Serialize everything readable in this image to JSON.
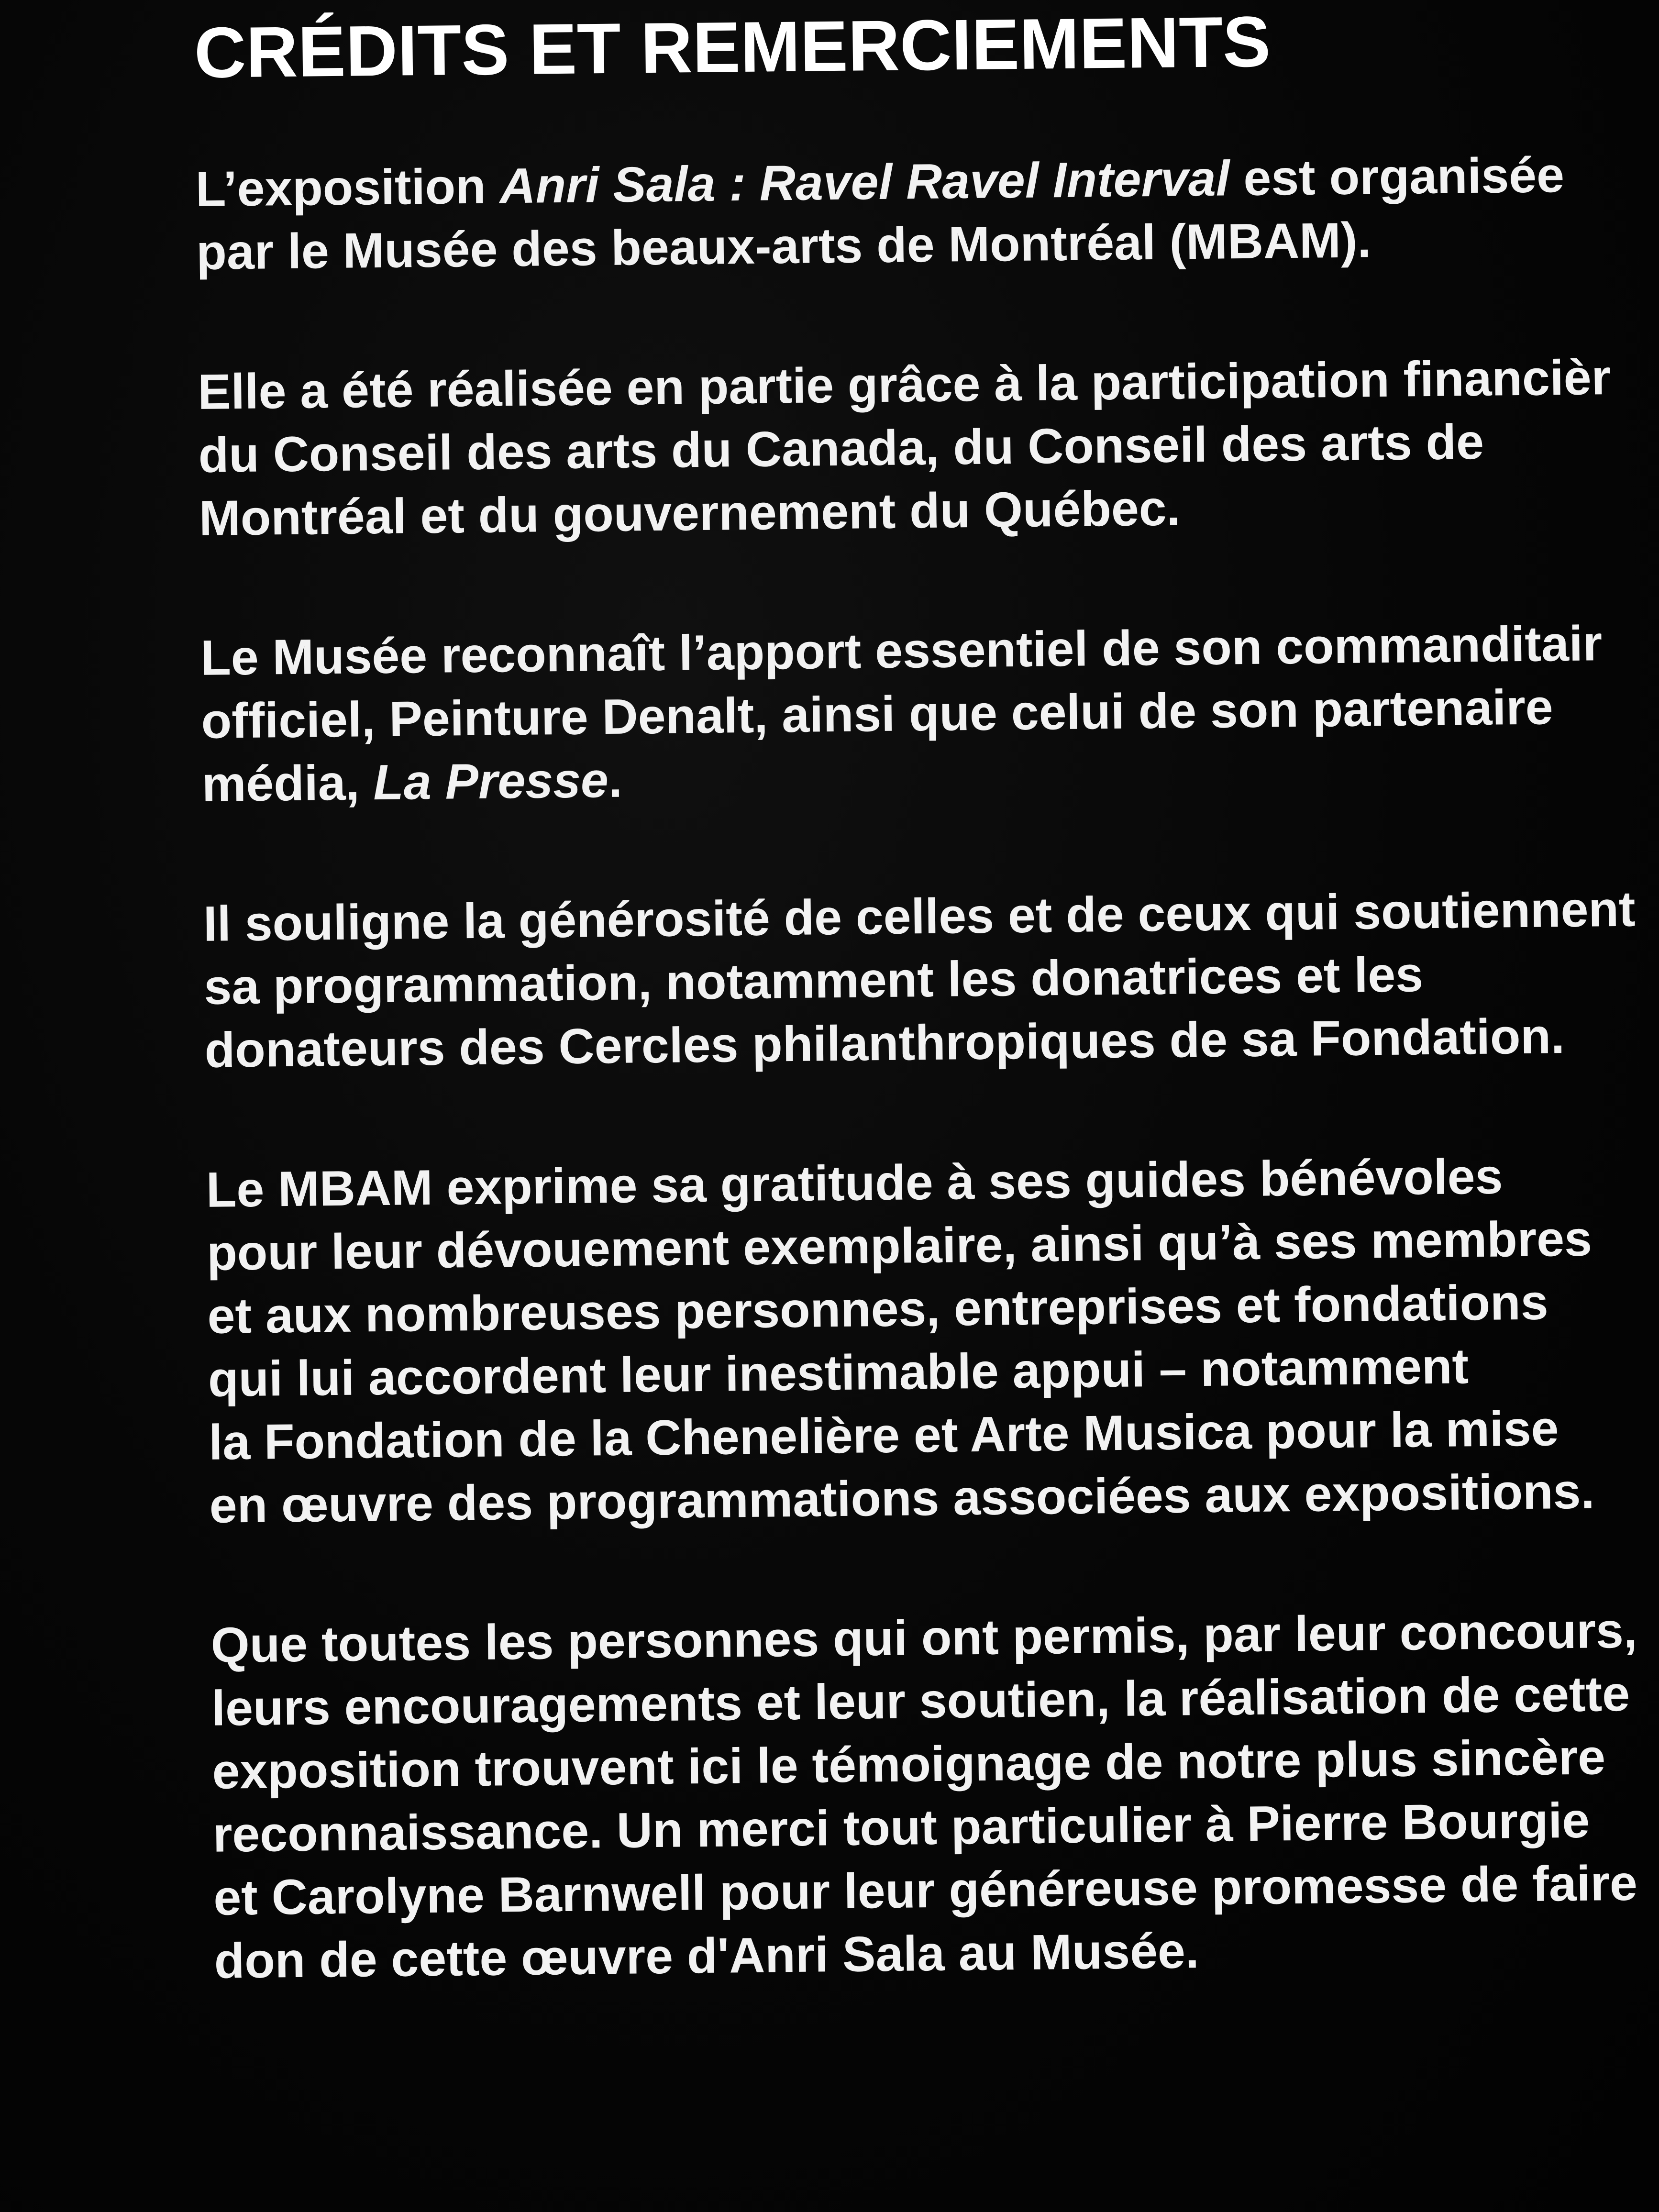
{
  "title": "CRÉDITS ET REMERCIEMENTS",
  "paragraphs": [
    {
      "lines": [
        "L’exposition ",
        "Anri Sala : Ravel Ravel Interval",
        " est organisée",
        "par le Musée des beaux-arts de Montréal (MBAM)."
      ]
    },
    {
      "lines": [
        "Elle a été réalisée en partie grâce à la participation financièr",
        "du Conseil des arts du Canada, du Conseil des arts de",
        "Montréal et du gouvernement du Québec."
      ]
    },
    {
      "lines": [
        "Le Musée reconnaît l’apport essentiel de son commanditair",
        "officiel, Peinture Denalt, ainsi que celui de son partenaire",
        "média, ",
        "La Presse",
        "."
      ]
    },
    {
      "lines": [
        "Il souligne la générosité de celles et de ceux qui soutiennent",
        "sa programmation, notamment les donatrices et les",
        "donateurs des Cercles philanthropiques de sa Fondation."
      ]
    },
    {
      "lines": [
        "Le MBAM exprime sa gratitude à ses guides bénévoles",
        "pour leur dévouement exemplaire, ainsi qu’à ses membres",
        "et aux nombreuses personnes, entreprises et fondations",
        "qui lui accordent leur inestimable appui – notamment",
        "la Fondation de la Chenelière et Arte Musica pour la mise",
        "en œuvre des programmations associées aux expositions."
      ]
    },
    {
      "lines": [
        "Que toutes les personnes qui ont permis, par leur concours,",
        "leurs encouragements et leur soutien, la réalisation de cette",
        "exposition trouvent ici le témoignage de notre plus sincère",
        "reconnaissance. Un merci tout particulier à Pierre Bourgie",
        "et Carolyne Barnwell pour leur généreuse promesse de faire",
        "don de cette œuvre d'Anri Sala au Musée."
      ]
    }
  ]
}
